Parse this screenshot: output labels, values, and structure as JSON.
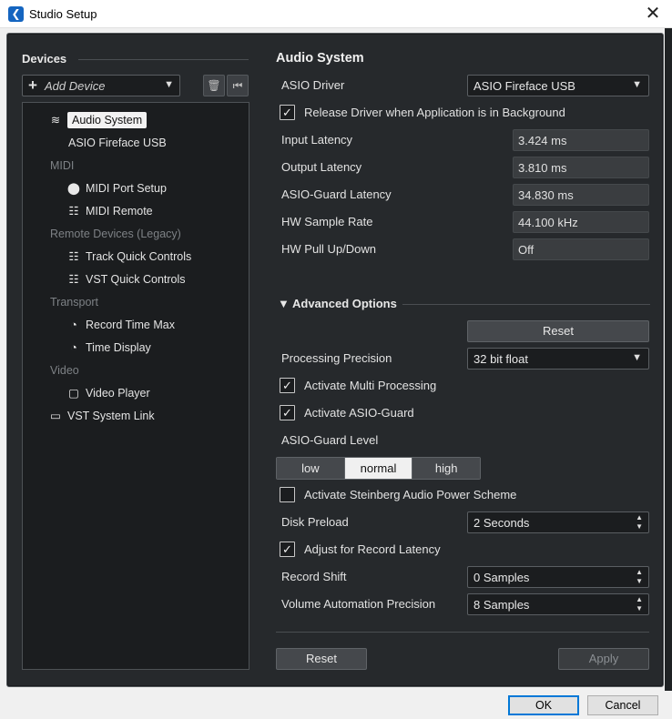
{
  "window": {
    "title": "Studio Setup",
    "app_icon_glyph": "❮",
    "close_glyph": "✕"
  },
  "devices": {
    "header": "Devices",
    "add_device_label": "Add Device",
    "tree": [
      {
        "label": "Audio System",
        "icon": "waveform-icon",
        "glyph": "≋",
        "selected": true
      },
      {
        "label": "ASIO Fireface USB",
        "icon": "",
        "glyph": ""
      },
      {
        "label": "MIDI",
        "category": true
      },
      {
        "label": "MIDI Port Setup",
        "icon": "midi-port-icon",
        "glyph": "⬤"
      },
      {
        "label": "MIDI Remote",
        "icon": "keyboard-icon",
        "glyph": "☷"
      },
      {
        "label": "Remote Devices (Legacy)",
        "category": true
      },
      {
        "label": "Track Quick Controls",
        "icon": "keyboard-icon",
        "glyph": "☷"
      },
      {
        "label": "VST Quick Controls",
        "icon": "keyboard-icon",
        "glyph": "☷"
      },
      {
        "label": "Transport",
        "category": true
      },
      {
        "label": "Record Time Max",
        "icon": "clock-icon",
        "glyph": "◔"
      },
      {
        "label": "Time Display",
        "icon": "clock-icon",
        "glyph": "◔"
      },
      {
        "label": "Video",
        "category": true
      },
      {
        "label": "Video Player",
        "icon": "video-frame-icon",
        "glyph": "▢"
      },
      {
        "label": "VST System Link",
        "icon": "monitor-icon",
        "glyph": "▭"
      }
    ]
  },
  "audio_system": {
    "title": "Audio System",
    "asio_driver_label": "ASIO Driver",
    "asio_driver_value": "ASIO Fireface USB",
    "release_driver_label": "Release Driver when Application is in Background",
    "release_driver_checked": true,
    "input_latency_label": "Input Latency",
    "input_latency_value": "3.424 ms",
    "output_latency_label": "Output Latency",
    "output_latency_value": "3.810 ms",
    "asio_guard_latency_label": "ASIO-Guard Latency",
    "asio_guard_latency_value": "34.830 ms",
    "hw_sample_rate_label": "HW Sample Rate",
    "hw_sample_rate_value": "44.100 kHz",
    "hw_pull_label": "HW Pull Up/Down",
    "hw_pull_value": "Off"
  },
  "advanced": {
    "header": "Advanced Options",
    "reset_label": "Reset",
    "processing_precision_label": "Processing Precision",
    "processing_precision_value": "32 bit float",
    "multi_processing_label": "Activate Multi Processing",
    "multi_processing_checked": true,
    "asio_guard_label": "Activate ASIO-Guard",
    "asio_guard_checked": true,
    "asio_guard_level_label": "ASIO-Guard Level",
    "asio_guard_levels": [
      "low",
      "normal",
      "high"
    ],
    "asio_guard_level_selected": "normal",
    "power_scheme_label": "Activate Steinberg Audio Power Scheme",
    "power_scheme_checked": false,
    "disk_preload_label": "Disk Preload",
    "disk_preload_value": "2 Seconds",
    "adjust_latency_label": "Adjust for Record Latency",
    "adjust_latency_checked": true,
    "record_shift_label": "Record Shift",
    "record_shift_value": "0 Samples",
    "volume_precision_label": "Volume Automation Precision",
    "volume_precision_value": "8 Samples"
  },
  "panel_footer": {
    "reset_label": "Reset",
    "apply_label": "Apply"
  },
  "dialog_footer": {
    "ok_label": "OK",
    "cancel_label": "Cancel"
  },
  "colors": {
    "panel_bg": "#26292c",
    "field_bg": "#1b1d1f",
    "selected_bg": "#f2f2f2",
    "primary_border": "#0078d7"
  }
}
